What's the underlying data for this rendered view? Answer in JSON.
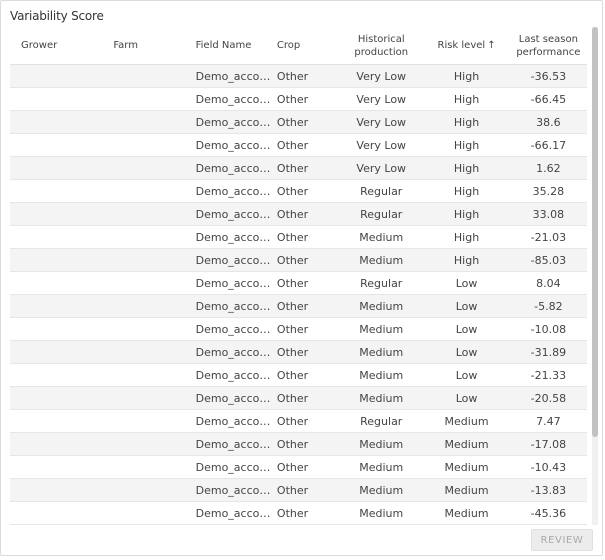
{
  "panel": {
    "title": "Variability Score"
  },
  "table": {
    "columns": {
      "grower": "Grower",
      "farm": "Farm",
      "field_name": "Field Name",
      "crop": "Crop",
      "historical_production_line1": "Historical",
      "historical_production_line2": "production",
      "risk_level": "Risk level",
      "risk_level_sort_icon": "↑",
      "last_season_line1": "Last season",
      "last_season_line2": "performance"
    },
    "rows": [
      {
        "grower": "",
        "farm": "",
        "field": "Demo_accou…",
        "crop": "Other",
        "historical": "Very Low",
        "risk": "High",
        "last": "-36.53"
      },
      {
        "grower": "",
        "farm": "",
        "field": "Demo_accou…",
        "crop": "Other",
        "historical": "Very Low",
        "risk": "High",
        "last": "-66.45"
      },
      {
        "grower": "",
        "farm": "",
        "field": "Demo_accou…",
        "crop": "Other",
        "historical": "Very Low",
        "risk": "High",
        "last": "38.6"
      },
      {
        "grower": "",
        "farm": "",
        "field": "Demo_accou…",
        "crop": "Other",
        "historical": "Very Low",
        "risk": "High",
        "last": "-66.17"
      },
      {
        "grower": "",
        "farm": "",
        "field": "Demo_accou…",
        "crop": "Other",
        "historical": "Very Low",
        "risk": "High",
        "last": "1.62"
      },
      {
        "grower": "",
        "farm": "",
        "field": "Demo_accou…",
        "crop": "Other",
        "historical": "Regular",
        "risk": "High",
        "last": "35.28"
      },
      {
        "grower": "",
        "farm": "",
        "field": "Demo_accou…",
        "crop": "Other",
        "historical": "Regular",
        "risk": "High",
        "last": "33.08"
      },
      {
        "grower": "",
        "farm": "",
        "field": "Demo_accou…",
        "crop": "Other",
        "historical": "Medium",
        "risk": "High",
        "last": "-21.03"
      },
      {
        "grower": "",
        "farm": "",
        "field": "Demo_accou…",
        "crop": "Other",
        "historical": "Medium",
        "risk": "High",
        "last": "-85.03"
      },
      {
        "grower": "",
        "farm": "",
        "field": "Demo_accou…",
        "crop": "Other",
        "historical": "Regular",
        "risk": "Low",
        "last": "8.04"
      },
      {
        "grower": "",
        "farm": "",
        "field": "Demo_accou…",
        "crop": "Other",
        "historical": "Medium",
        "risk": "Low",
        "last": "-5.82"
      },
      {
        "grower": "",
        "farm": "",
        "field": "Demo_accou…",
        "crop": "Other",
        "historical": "Medium",
        "risk": "Low",
        "last": "-10.08"
      },
      {
        "grower": "",
        "farm": "",
        "field": "Demo_accou…",
        "crop": "Other",
        "historical": "Medium",
        "risk": "Low",
        "last": "-31.89"
      },
      {
        "grower": "",
        "farm": "",
        "field": "Demo_accou…",
        "crop": "Other",
        "historical": "Medium",
        "risk": "Low",
        "last": "-21.33"
      },
      {
        "grower": "",
        "farm": "",
        "field": "Demo_accou…",
        "crop": "Other",
        "historical": "Medium",
        "risk": "Low",
        "last": "-20.58"
      },
      {
        "grower": "",
        "farm": "",
        "field": "Demo_accou…",
        "crop": "Other",
        "historical": "Regular",
        "risk": "Medium",
        "last": "7.47"
      },
      {
        "grower": "",
        "farm": "",
        "field": "Demo_accou…",
        "crop": "Other",
        "historical": "Medium",
        "risk": "Medium",
        "last": "-17.08"
      },
      {
        "grower": "",
        "farm": "",
        "field": "Demo_accou…",
        "crop": "Other",
        "historical": "Medium",
        "risk": "Medium",
        "last": "-10.43"
      },
      {
        "grower": "",
        "farm": "",
        "field": "Demo_accou…",
        "crop": "Other",
        "historical": "Medium",
        "risk": "Medium",
        "last": "-13.83"
      },
      {
        "grower": "",
        "farm": "",
        "field": "Demo_accou…",
        "crop": "Other",
        "historical": "Medium",
        "risk": "Medium",
        "last": "-45.36"
      }
    ]
  },
  "actions": {
    "review_label": "REVIEW"
  },
  "colors": {
    "row_alt": "#f4f4f4",
    "button_disabled_bg": "#ececec",
    "button_disabled_text": "#a9a9a9"
  }
}
